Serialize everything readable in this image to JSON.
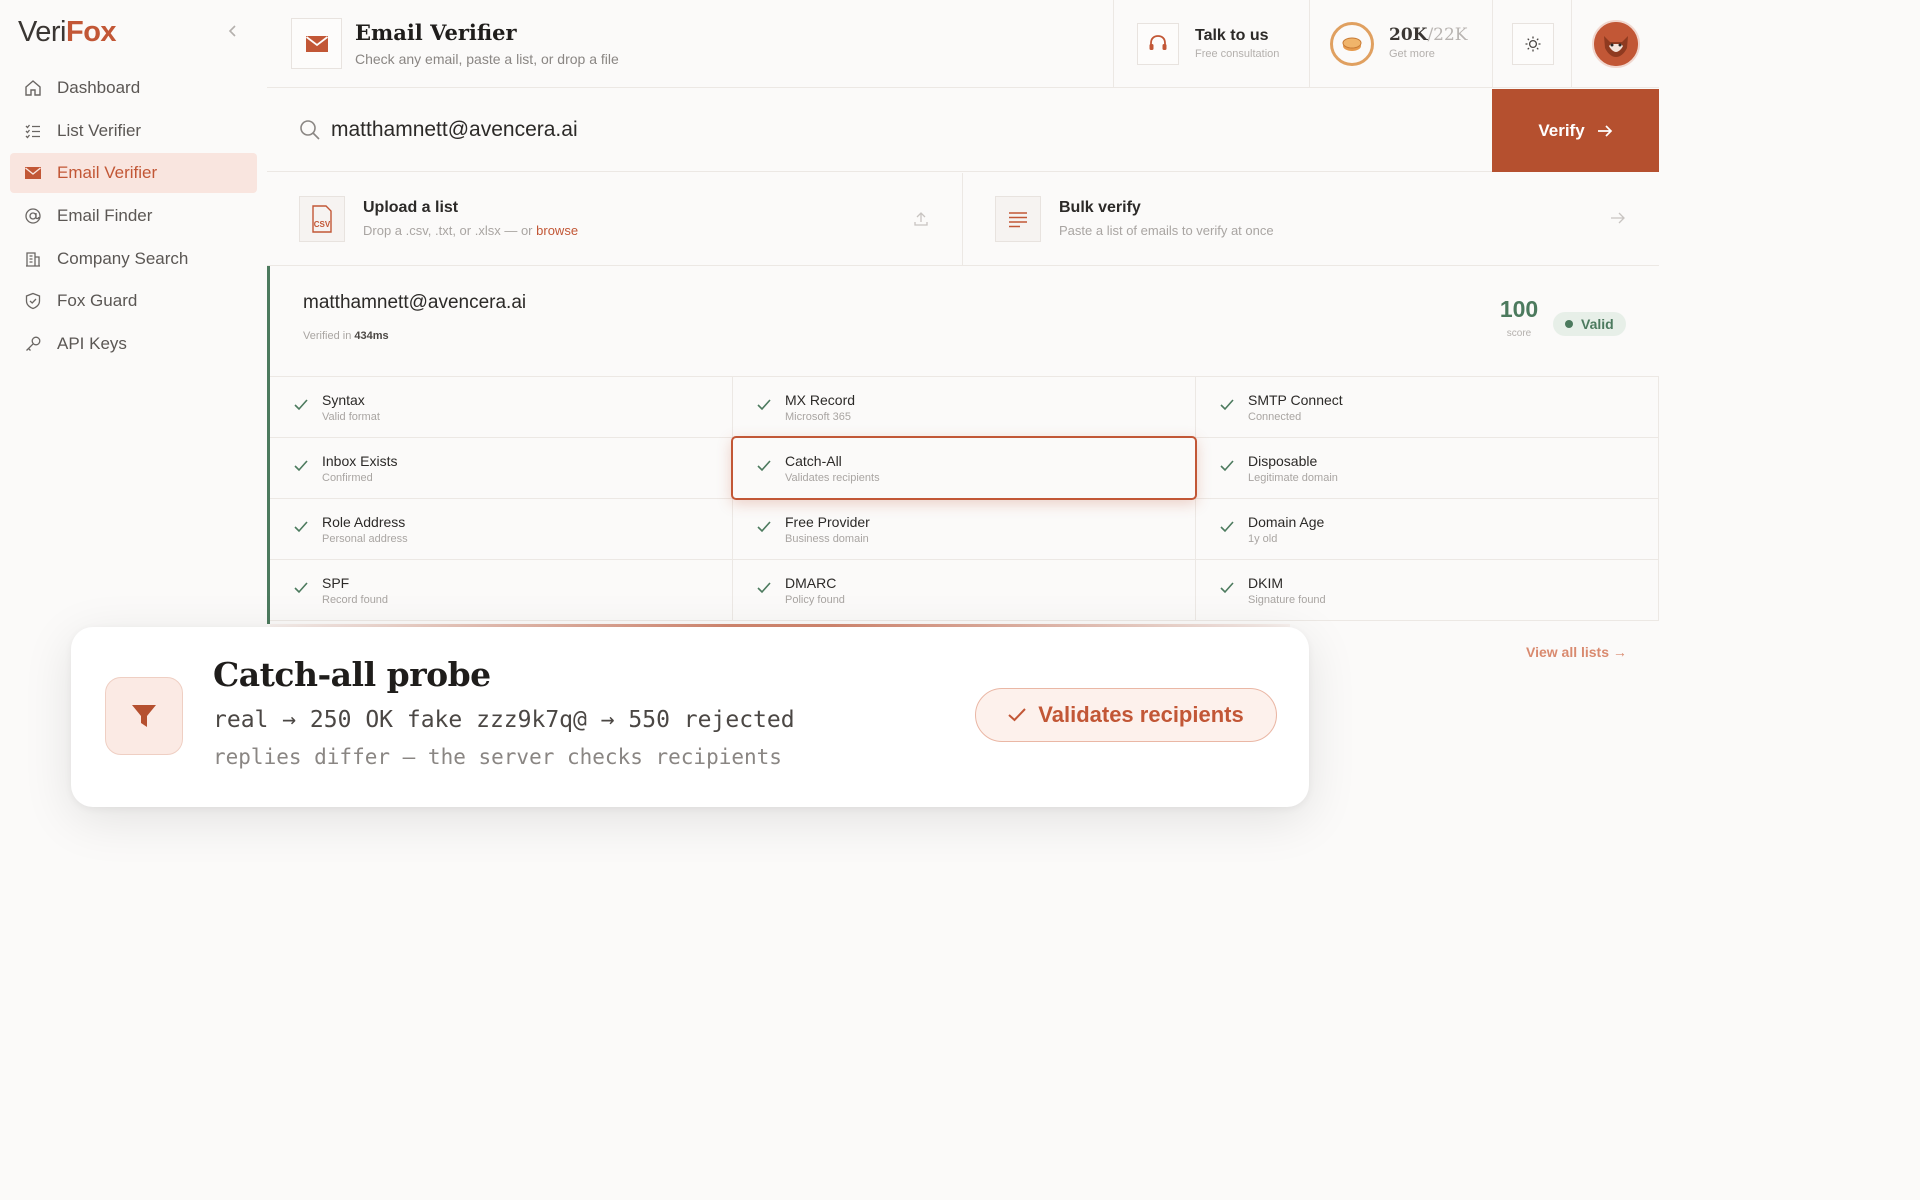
{
  "app": {
    "logo_part1": "Veri",
    "logo_part2": "Fox"
  },
  "sidebar": {
    "items": [
      {
        "label": "Dashboard",
        "icon": "home-icon"
      },
      {
        "label": "List Verifier",
        "icon": "list-icon"
      },
      {
        "label": "Email Verifier",
        "icon": "mail-icon",
        "active": true
      },
      {
        "label": "Email Finder",
        "icon": "at-icon"
      },
      {
        "label": "Company Search",
        "icon": "building-icon"
      },
      {
        "label": "Fox Guard",
        "icon": "shield-icon"
      },
      {
        "label": "API Keys",
        "icon": "key-icon"
      }
    ]
  },
  "header": {
    "title": "Email Verifier",
    "subtitle": "Check any email, paste a list, or drop a file",
    "talk_title": "Talk to us",
    "talk_sub": "Free consultation",
    "credits_used": "20K",
    "credits_total": "/22K",
    "credits_sub": "Get more"
  },
  "search": {
    "value": "matthamnett@avencera.ai",
    "verify_label": "Verify"
  },
  "upload": {
    "title": "Upload a list",
    "sub_prefix": "Drop a .csv, .txt, or .xlsx — or ",
    "browse": "browse",
    "badge": "CSV"
  },
  "bulk": {
    "title": "Bulk verify",
    "sub": "Paste a list of emails to verify at once"
  },
  "result": {
    "email": "matthamnett@avencera.ai",
    "verified_prefix": "Verified in ",
    "verified_time": "434ms",
    "score": "100",
    "score_label": "score",
    "status": "Valid",
    "checks": [
      {
        "title": "Syntax",
        "sub": "Valid format"
      },
      {
        "title": "MX Record",
        "sub": "Microsoft 365"
      },
      {
        "title": "SMTP Connect",
        "sub": "Connected"
      },
      {
        "title": "Inbox Exists",
        "sub": "Confirmed"
      },
      {
        "title": "Catch-All",
        "sub": "Validates recipients"
      },
      {
        "title": "Disposable",
        "sub": "Legitimate domain"
      },
      {
        "title": "Role Address",
        "sub": "Personal address"
      },
      {
        "title": "Free Provider",
        "sub": "Business domain"
      },
      {
        "title": "Domain Age",
        "sub": "1y old"
      },
      {
        "title": "SPF",
        "sub": "Record found"
      },
      {
        "title": "DMARC",
        "sub": "Policy found"
      },
      {
        "title": "DKIM",
        "sub": "Signature found"
      }
    ]
  },
  "lists": {
    "view_all": "View all lists"
  },
  "probe": {
    "title": "Catch-all probe",
    "line1": "real → 250 OK fake zzz9k7q@ → 550 rejected",
    "line2": "replies differ — the server checks recipients",
    "verdict": "Validates recipients",
    "icon": "funnel-icon"
  },
  "colors": {
    "accent": "#c25736",
    "accent_dark": "#b5502f",
    "valid": "#4c7a5e",
    "active_bg": "#f9e5df"
  }
}
